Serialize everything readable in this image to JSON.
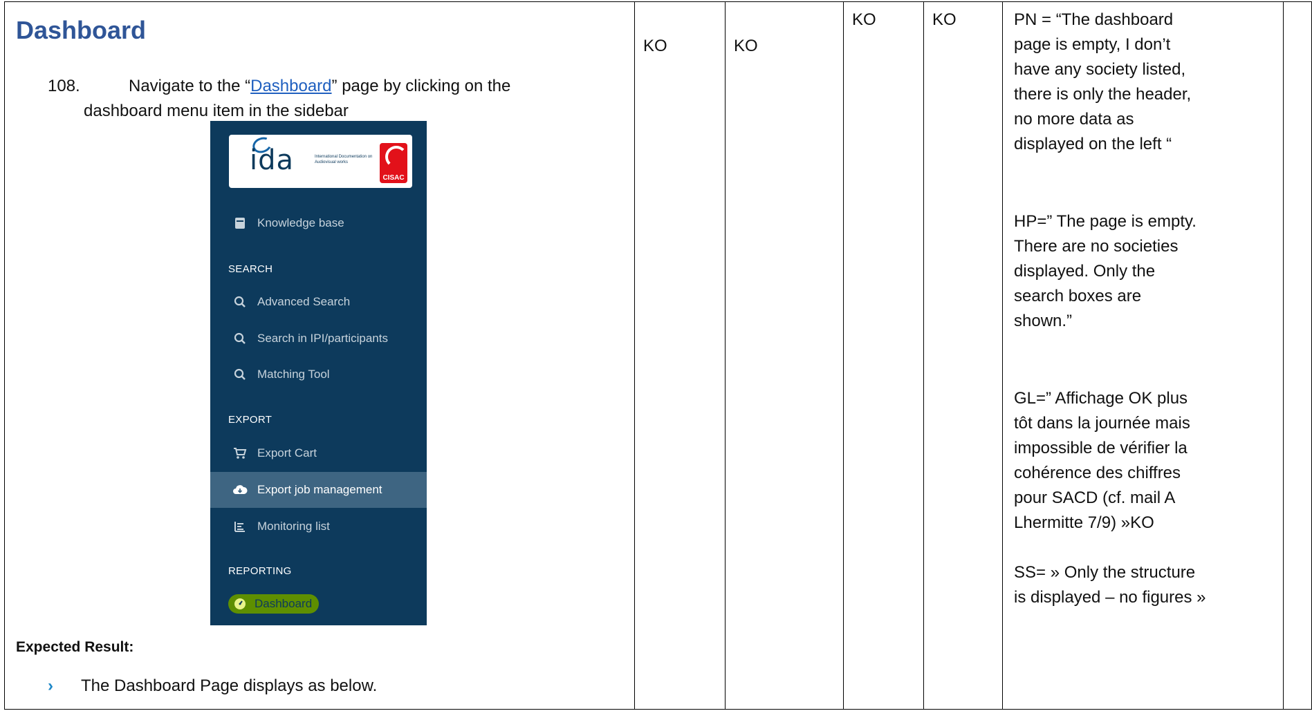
{
  "heading": "Dashboard",
  "step": {
    "number": "108.",
    "pre": "Navigate to the “",
    "link": "Dashboard",
    "post": "” page by clicking on the",
    "line2": "dashboard menu item in the sidebar"
  },
  "sidebar": {
    "logo": {
      "ida": "ida",
      "subtitle": "International Documentation on Audiovisual works",
      "cisac": "CISAC"
    },
    "items": [
      {
        "type": "item",
        "icon": "book-icon",
        "label": "Knowledge base"
      },
      {
        "type": "section",
        "label": "SEARCH"
      },
      {
        "type": "item",
        "icon": "search-icon",
        "label": "Advanced Search"
      },
      {
        "type": "item",
        "icon": "search-icon",
        "label": "Search in IPI/participants"
      },
      {
        "type": "item",
        "icon": "search-icon",
        "label": "Matching Tool"
      },
      {
        "type": "section",
        "label": "EXPORT"
      },
      {
        "type": "item",
        "icon": "cart-icon",
        "label": "Export Cart"
      },
      {
        "type": "item",
        "icon": "cloud-download-icon",
        "label": "Export job management",
        "active": true
      },
      {
        "type": "item",
        "icon": "list-icon",
        "label": "Monitoring list"
      },
      {
        "type": "section",
        "label": "REPORTING"
      },
      {
        "type": "item",
        "icon": "dashboard-icon",
        "label": "Dashboard",
        "highlighted": true
      }
    ]
  },
  "expected": {
    "heading": "Expected Result:",
    "bullet": "The Dashboard Page displays as below."
  },
  "results": {
    "col_a": "KO",
    "col_b": "KO",
    "col_c": "KO",
    "col_d": "KO"
  },
  "comments": {
    "pn": [
      "PN = “The dashboard",
      "page is empty, I don’t",
      "have any society listed,",
      "there is only the header,",
      "no more data as",
      "displayed on the left “"
    ],
    "hp": [
      "HP=” The page is empty.",
      "There are no societies",
      "displayed. Only the",
      "search boxes are",
      "shown.”"
    ],
    "gl": [
      "GL=” Affichage OK plus",
      "tôt dans la journée mais",
      "impossible de vérifier la",
      "cohérence des chiffres",
      "pour SACD (cf. mail A",
      "Lhermitte 7/9) »KO"
    ],
    "ss": [
      "SS= » Only the structure",
      "is displayed – no figures »"
    ]
  },
  "colors": {
    "heading": "#2f5597",
    "link": "#1f5fbf",
    "sidebar_bg": "#0d3a5c",
    "sidebar_active": "#3e6582",
    "highlight": "#5e8f00",
    "bullet": "#1e88c8"
  }
}
